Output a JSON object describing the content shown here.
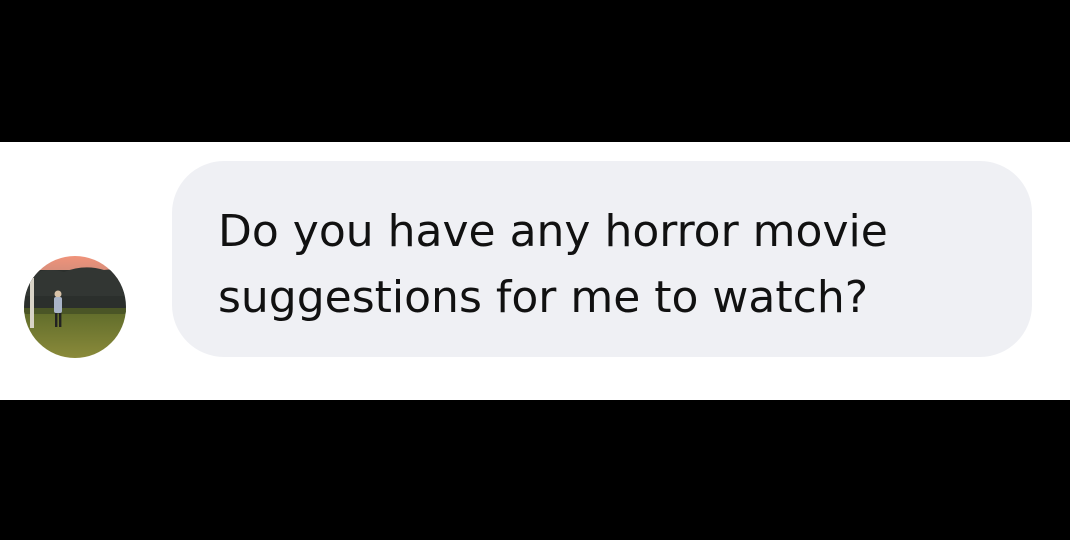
{
  "message": {
    "text": "Do you have any horror movie\nsuggestions for me to watch?",
    "avatar_icon": "user-photo-avatar",
    "bubble_color": "#eff0f4",
    "text_color": "#111111"
  },
  "colors": {
    "letterbox": "#000000",
    "chat_background": "#ffffff"
  }
}
